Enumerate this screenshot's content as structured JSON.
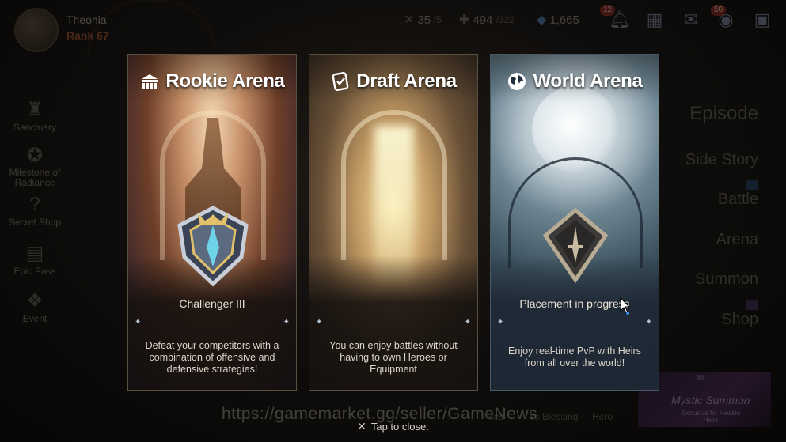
{
  "player": {
    "name": "Theonia",
    "rank": "Rank 67"
  },
  "resources": [
    {
      "icon": "stamina-icon",
      "value": "35",
      "max": "/5"
    },
    {
      "icon": "energy-icon",
      "value": "494",
      "max": "/322"
    },
    {
      "icon": "crystal-icon",
      "value": "1,665",
      "max": ""
    }
  ],
  "top_icons": {
    "notifications_badge": "12",
    "chat_badge": "50"
  },
  "left_menu": [
    {
      "label": "Sanctuary",
      "icon": "castle-icon"
    },
    {
      "label": "Milestone of Radiance",
      "icon": "star-emblem-icon"
    },
    {
      "label": "Secret Shop",
      "icon": "question-icon"
    },
    {
      "label": "Epic Pass",
      "icon": "pass-icon"
    },
    {
      "label": "Event",
      "icon": "event-icon"
    }
  ],
  "right_menu": {
    "episode": "Episode",
    "side_story": "Side Story",
    "battle": "Battle",
    "arena": "Arena",
    "summon": "Summon",
    "shop": "Shop"
  },
  "banner": {
    "title": "Mystic Summon",
    "subtitle": "Exclusive for Newbie Heirs"
  },
  "bottom_menu": {
    "hero": "Hero",
    "blessing": "t's Blessing",
    "res": "Res"
  },
  "cards": [
    {
      "id": "rookie",
      "title": "Rookie Arena",
      "icon": "colosseum-icon",
      "status": "Challenger III",
      "description": "Defeat your competitors with a combination of offensive and defensive strategies!"
    },
    {
      "id": "draft",
      "title": "Draft Arena",
      "icon": "card-check-icon",
      "status": "",
      "description": "You can enjoy battles without having to own Heroes or Equipment"
    },
    {
      "id": "world",
      "title": "World Arena",
      "icon": "globe-icon",
      "status": "Placement in progress",
      "description": "Enjoy real-time PvP with Heirs from all over the world!"
    }
  ],
  "watermark": "https://gamemarket.gg/seller/GameNews",
  "close_hint": "Tap to close.",
  "colors": {
    "title": "#ffffff",
    "rank": "#8a4a2a",
    "world_tint": "#3b4f5c"
  }
}
